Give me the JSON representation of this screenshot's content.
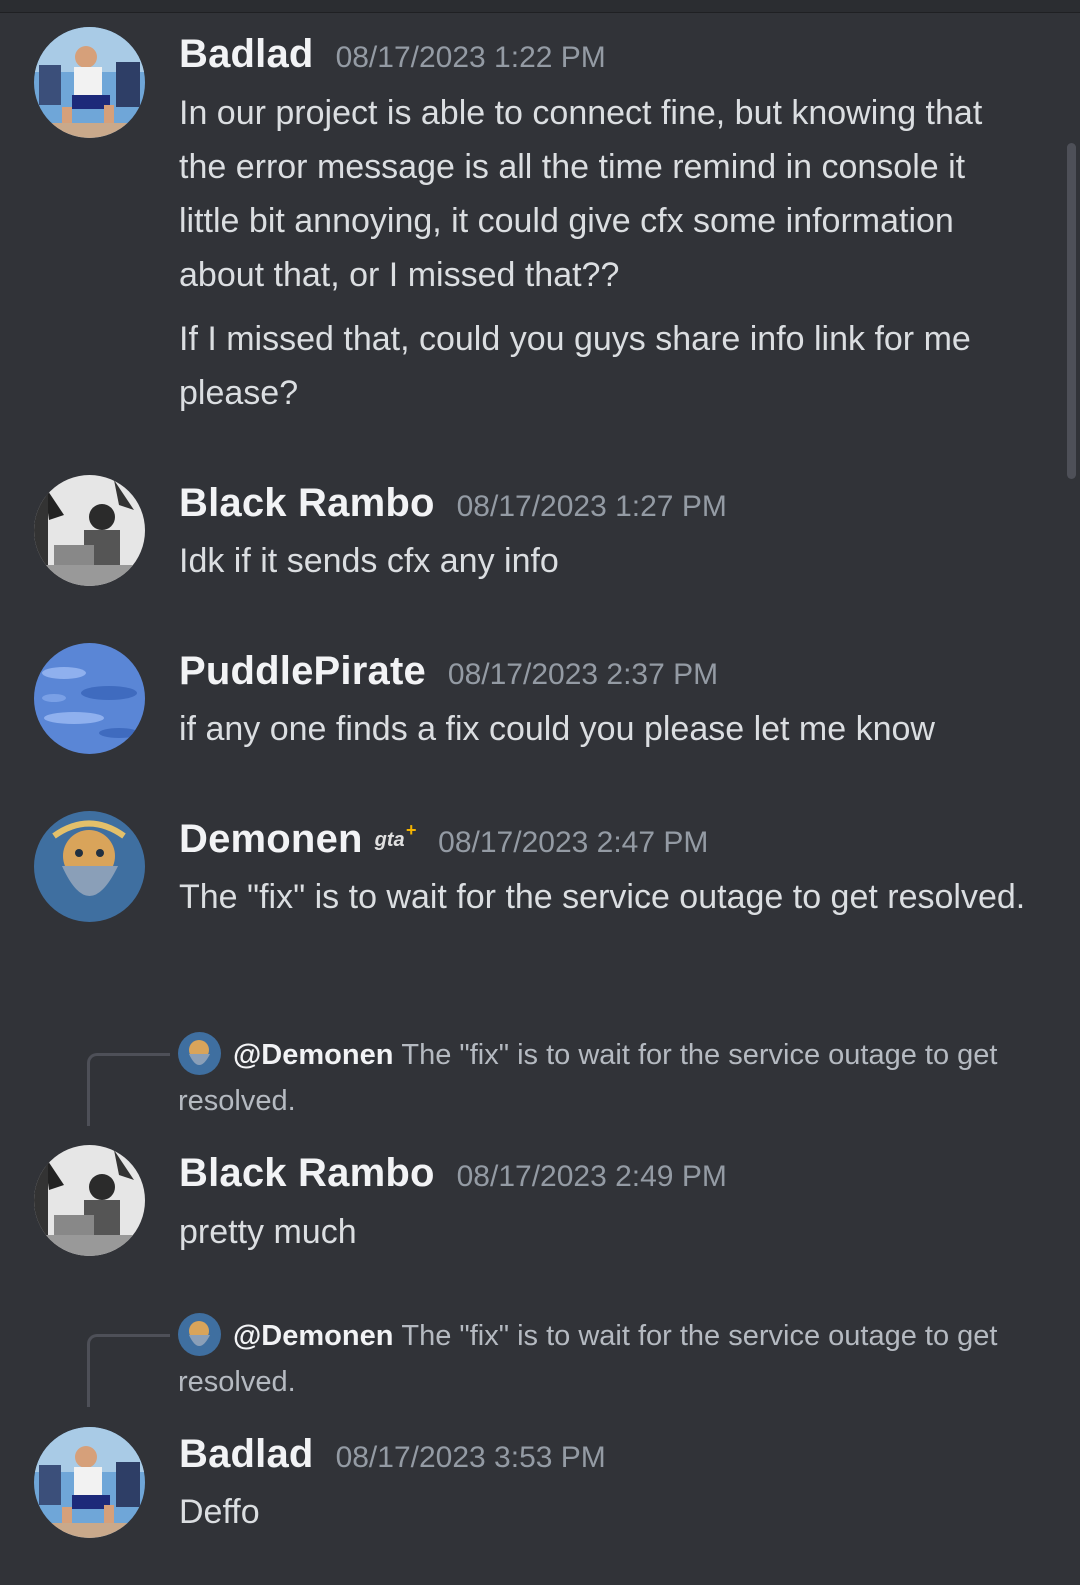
{
  "channel": {
    "messages": [
      {
        "author": "Badlad",
        "avatar": "badlad-avatar",
        "timestamp": "08/17/2023 1:22 PM",
        "paragraphs": [
          "In our project is able to connect fine, but knowing that the error message is all the time remind in console it little bit annoying, it could give cfx some information about that, or I missed that??",
          "If I missed that, could you guys share info link for me please?"
        ]
      },
      {
        "author": "Black Rambo",
        "avatar": "black-rambo-avatar",
        "timestamp": "08/17/2023 1:27 PM",
        "paragraphs": [
          "Idk if it sends cfx any info"
        ]
      },
      {
        "author": "PuddlePirate",
        "avatar": "puddlepirate-avatar",
        "timestamp": "08/17/2023 2:37 PM",
        "paragraphs": [
          "if any one finds a fix could you please let me know"
        ]
      },
      {
        "author": "Demonen",
        "avatar": "demonen-avatar",
        "badge": "gta",
        "badge_icon": "gta-plus-icon",
        "timestamp": "08/17/2023 2:47 PM",
        "paragraphs": [
          "The \"fix\" is to wait for the service outage to get resolved."
        ]
      },
      {
        "reply": {
          "mention": "@Demonen",
          "text": "The \"fix\" is to wait for the service outage to get resolved."
        },
        "author": "Black Rambo",
        "avatar": "black-rambo-avatar",
        "timestamp": "08/17/2023 2:49 PM",
        "paragraphs": [
          "pretty much"
        ]
      },
      {
        "reply": {
          "mention": "@Demonen",
          "text": "The \"fix\" is to wait for the service outage to get resolved."
        },
        "author": "Badlad",
        "avatar": "badlad-avatar",
        "timestamp": "08/17/2023 3:53 PM",
        "paragraphs": [
          "Deffo"
        ]
      }
    ]
  },
  "colors": {
    "background": "#313338",
    "username": "#f2f3f5",
    "timestamp": "#949ba4",
    "message_text": "#dbdee1",
    "reply_text": "#b5bac1"
  }
}
